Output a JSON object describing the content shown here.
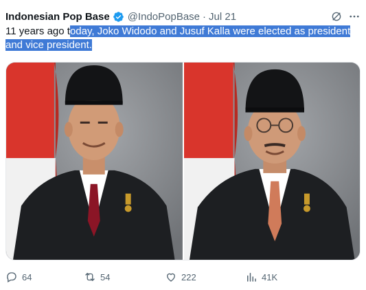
{
  "tweet": {
    "author_name": "Indonesian Pop Base",
    "handle": "@IndoPopBase",
    "separator": "·",
    "date": "Jul 21",
    "text_prefix": "11 years ago t",
    "text_selected": "oday, Joko Widodo and Jusuf Kalla were elected as president and vice president.",
    "images": [
      "photo-left",
      "photo-right"
    ]
  },
  "actions": {
    "replies": "64",
    "reposts": "54",
    "likes": "222",
    "views": "41K"
  },
  "colors": {
    "selection": "#3f7ad6",
    "verified": "#1d9bf0",
    "muted": "#536471"
  }
}
